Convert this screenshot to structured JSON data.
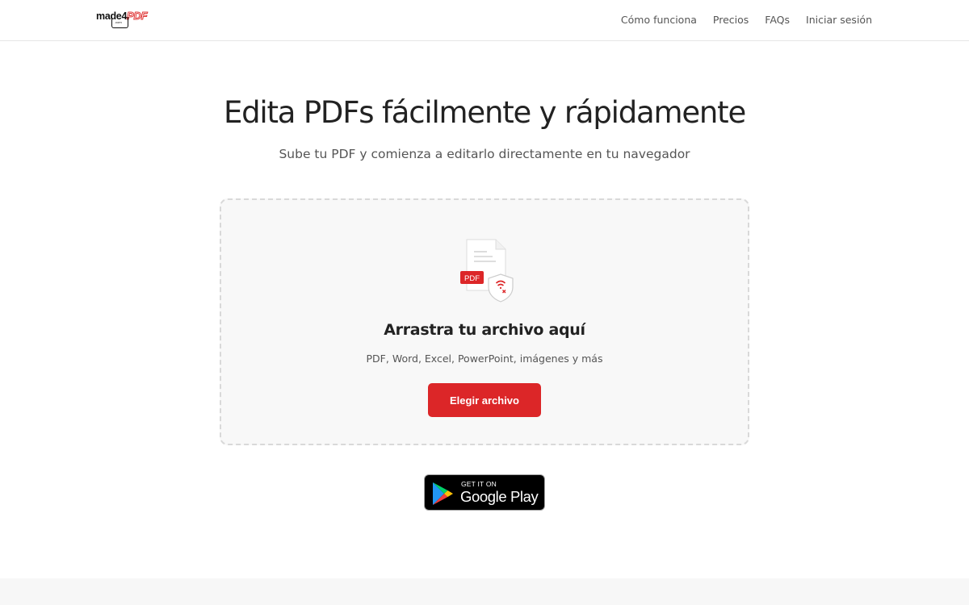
{
  "header": {
    "logo": {
      "text_main": "made4",
      "text_accent": "PDF",
      "text_sub": ".com"
    },
    "nav": [
      {
        "label": "Cómo funciona"
      },
      {
        "label": "Precios"
      },
      {
        "label": "FAQs"
      },
      {
        "label": "Iniciar sesión"
      }
    ]
  },
  "hero": {
    "title": "Edita PDFs fácilmente y rápidamente",
    "subtitle": "Sube tu PDF y comienza a editarlo directamente en tu navegador"
  },
  "dropzone": {
    "icon": "pdf-shield-icon",
    "badge": "PDF",
    "title": "Arrastra tu archivo aquí",
    "formats": "PDF, Word, Excel, PowerPoint, imágenes y más",
    "button_label": "Elegir archivo"
  },
  "store_badge": {
    "icon": "google-play-icon",
    "small_text": "GET IT ON",
    "big_text": "Google Play"
  },
  "colors": {
    "accent": "#dc2628",
    "dropzone_bg": "#f8f8f8",
    "dropzone_border": "#d9d9d9",
    "footer_bg": "#f7f7f7"
  }
}
